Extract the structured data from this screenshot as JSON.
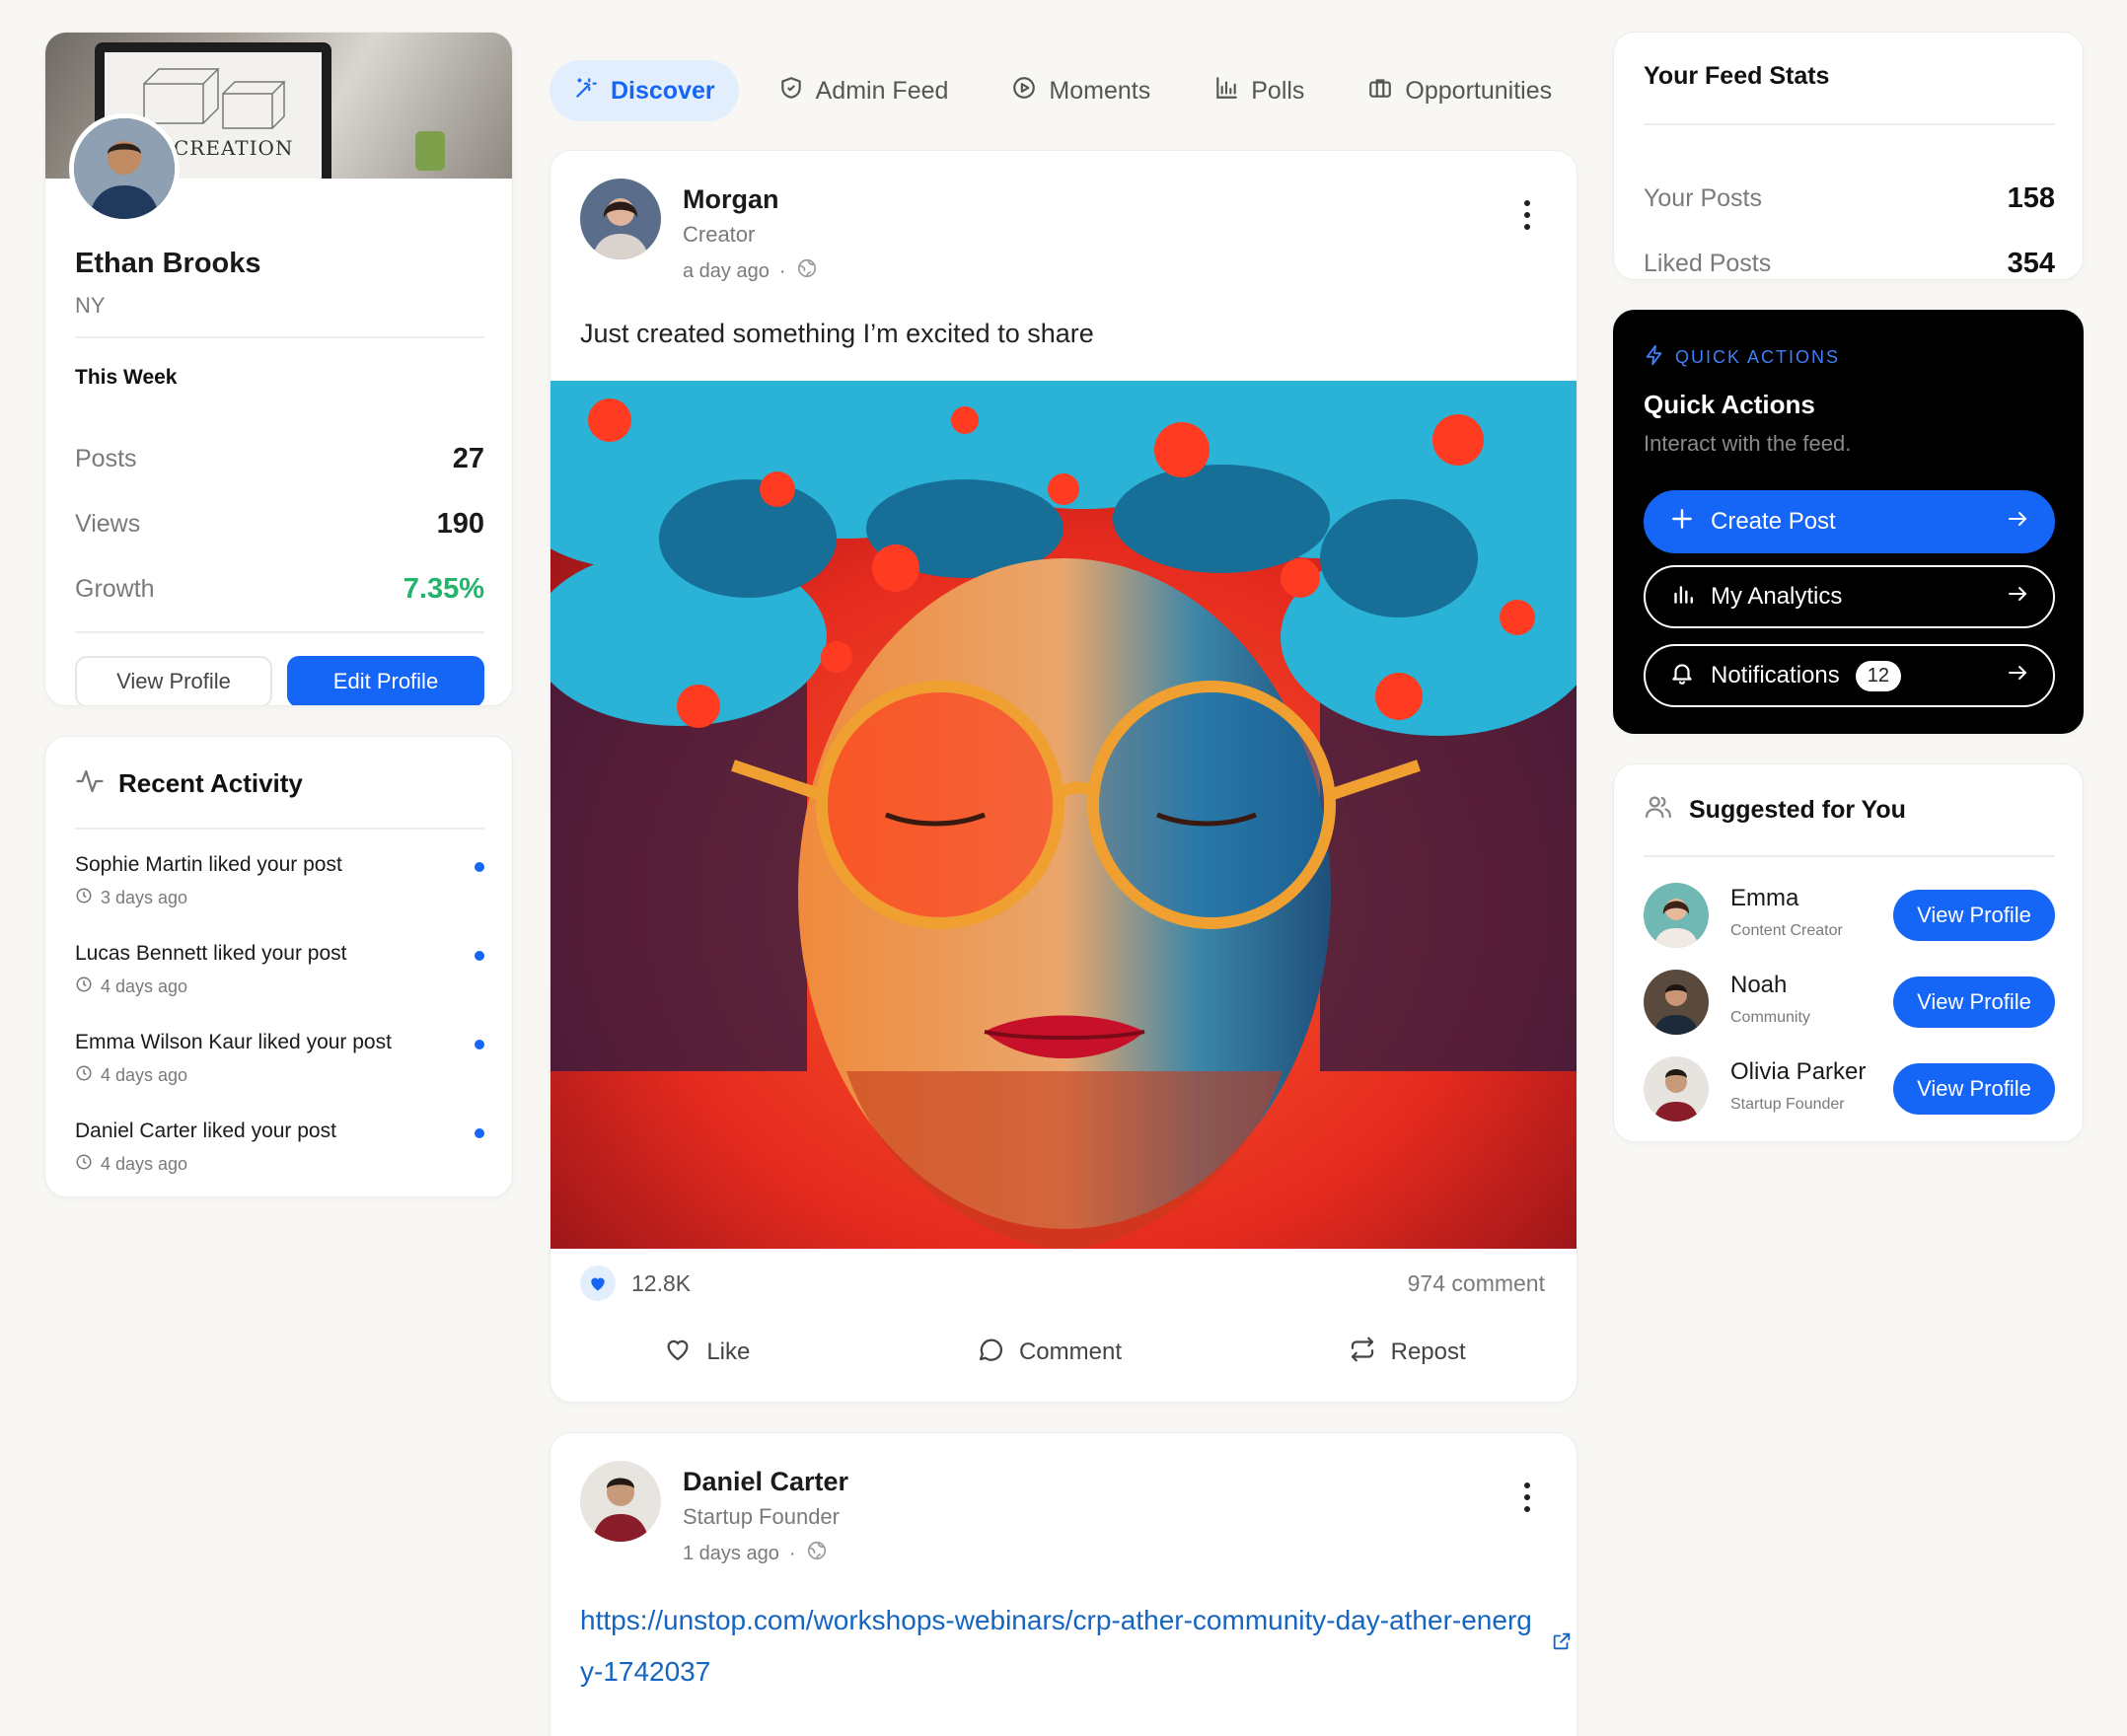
{
  "tabs": [
    {
      "label": "Discover",
      "icon": "magic-wand-icon",
      "active": true
    },
    {
      "label": "Admin Feed",
      "icon": "shield-icon",
      "active": false
    },
    {
      "label": "Moments",
      "icon": "play-circle-icon",
      "active": false
    },
    {
      "label": "Polls",
      "icon": "bar-chart-icon",
      "active": false
    },
    {
      "label": "Opportunities",
      "icon": "briefcase-icon",
      "active": false
    }
  ],
  "profile": {
    "cover_text": "CREATION",
    "name": "Ethan Brooks",
    "location": "NY",
    "this_week_title": "This Week",
    "stats": [
      {
        "label": "Posts",
        "value": "27"
      },
      {
        "label": "Views",
        "value": "190"
      },
      {
        "label": "Growth",
        "value": "7.35%"
      }
    ],
    "view_profile_label": "View Profile",
    "edit_profile_label": "Edit Profile"
  },
  "recent_activity": {
    "title": "Recent Activity",
    "items": [
      {
        "text": "Sophie Martin liked your post",
        "time": "3 days ago"
      },
      {
        "text": "Lucas Bennett liked your post",
        "time": "4 days ago"
      },
      {
        "text": "Emma Wilson Kaur liked your post",
        "time": "4 days ago"
      },
      {
        "text": "Daniel Carter liked your post",
        "time": "4 days ago"
      }
    ]
  },
  "posts": [
    {
      "author": "Morgan",
      "role": "Creator",
      "time": "a day ago",
      "text": "Just created something I’m excited to share",
      "likes": "12.8K",
      "comments": "974 comment",
      "actions": {
        "like": "Like",
        "comment": "Comment",
        "repost": "Repost"
      }
    },
    {
      "author": "Daniel Carter",
      "role": "Startup Founder",
      "time": "1 days ago",
      "link": "https://unstop.com/workshops-webinars/crp-ather-community-day-ather-energy-1742037"
    }
  ],
  "feed_stats": {
    "title": "Your Feed Stats",
    "rows": [
      {
        "label": "Your Posts",
        "value": "158"
      },
      {
        "label": "Liked Posts",
        "value": "354"
      }
    ]
  },
  "quick_actions": {
    "eyebrow": "QUICK ACTIONS",
    "title": "Quick Actions",
    "subtitle": "Interact with the feed.",
    "buttons": [
      {
        "label": "Create Post",
        "icon": "plus-icon"
      },
      {
        "label": "My Analytics",
        "icon": "analytics-icon"
      },
      {
        "label": "Notifications",
        "icon": "bell-icon",
        "badge": "12"
      }
    ]
  },
  "suggested": {
    "title": "Suggested for You",
    "button_label": "View Profile",
    "people": [
      {
        "name": "Emma",
        "role": "Content Creator"
      },
      {
        "name": "Noah",
        "role": "Community"
      },
      {
        "name": "Olivia Parker",
        "role": "Startup Founder"
      }
    ]
  },
  "colors": {
    "accent": "#1565f6",
    "growth": "#22b46c",
    "link": "#1565c0",
    "page_bg": "#f8f7f4"
  }
}
